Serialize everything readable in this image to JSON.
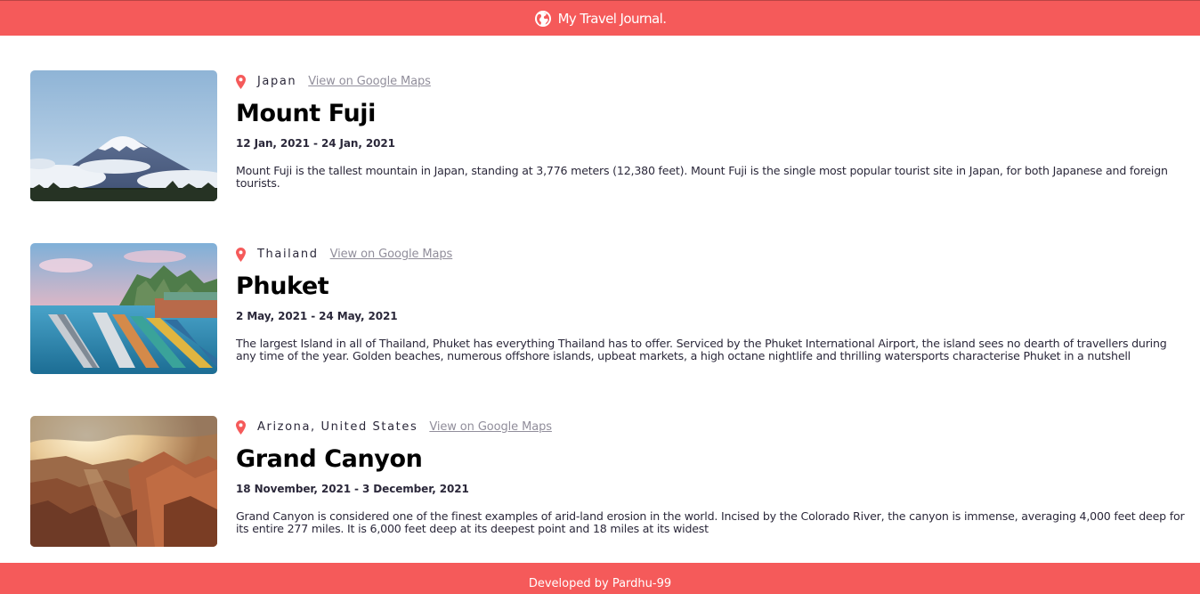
{
  "header": {
    "title": "My Travel Journal.",
    "icon": "globe-icon"
  },
  "entries": [
    {
      "location": "Japan",
      "map_link": "View on Google Maps",
      "title": "Mount Fuji",
      "dates": "12 Jan, 2021 - 24 Jan, 2021",
      "description": "Mount Fuji is the tallest mountain in Japan, standing at 3,776 meters (12,380 feet). Mount Fuji is the single most popular tourist site in Japan, for both Japanese and foreign tourists."
    },
    {
      "location": "Thailand",
      "map_link": "View on Google Maps",
      "title": "Phuket",
      "dates": "2 May, 2021 - 24 May, 2021",
      "description": "The largest Island in all of Thailand, Phuket has everything Thailand has to offer. Serviced by the Phuket International Airport, the island sees no dearth of travellers during any time of the year. Golden beaches, numerous offshore islands, upbeat markets, a high octane nightlife and thrilling watersports characterise Phuket in a nutshell"
    },
    {
      "location": "Arizona, United States",
      "map_link": "View on Google Maps",
      "title": "Grand Canyon",
      "dates": "18 November, 2021 - 3 December, 2021",
      "description": "Grand Canyon is considered one of the finest examples of arid-land erosion in the world. Incised by the Colorado River, the canyon is immense, averaging 4,000 feet deep for its entire 277 miles. It is 6,000 feet deep at its deepest point and 18 miles at its widest"
    }
  ],
  "footer": {
    "text": "Developed by Pardhu-99"
  },
  "colors": {
    "accent": "#f55a5a",
    "link": "#918e9b",
    "text": "#2b283a"
  }
}
